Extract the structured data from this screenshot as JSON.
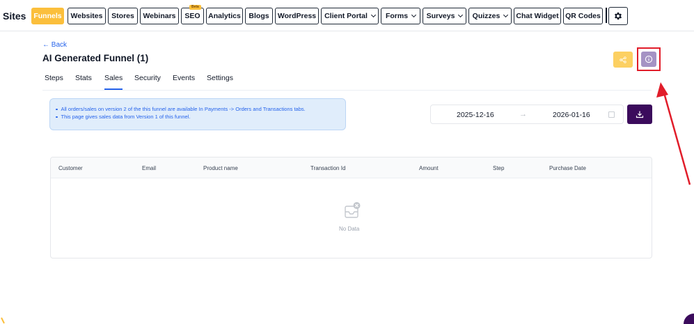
{
  "nav": {
    "title": "Sites",
    "items": [
      {
        "label": "Funnels",
        "dropdown": false,
        "active": true
      },
      {
        "label": "Websites",
        "dropdown": false
      },
      {
        "label": "Stores",
        "dropdown": false
      },
      {
        "label": "Webinars",
        "dropdown": false
      },
      {
        "label": "SEO",
        "dropdown": false,
        "badge": "Beta"
      },
      {
        "label": "Analytics",
        "dropdown": false
      },
      {
        "label": "Blogs",
        "dropdown": false
      },
      {
        "label": "WordPress",
        "dropdown": false
      },
      {
        "label": "Client Portal",
        "dropdown": true
      },
      {
        "label": "Forms",
        "dropdown": true
      },
      {
        "label": "Surveys",
        "dropdown": true
      },
      {
        "label": "Quizzes",
        "dropdown": true
      },
      {
        "label": "Chat Widget",
        "dropdown": false
      },
      {
        "label": "QR Codes",
        "dropdown": false
      }
    ],
    "settings_icon": "gear-icon"
  },
  "header": {
    "back_label": "← Back",
    "title": "AI Generated Funnel (1)",
    "share_icon": "share-icon",
    "info_icon": "info-icon"
  },
  "tabs": [
    {
      "label": "Steps"
    },
    {
      "label": "Stats"
    },
    {
      "label": "Sales",
      "active": true
    },
    {
      "label": "Security"
    },
    {
      "label": "Events"
    },
    {
      "label": "Settings"
    }
  ],
  "alert": {
    "lines": [
      "All orders/sales on version 2 of the this funnel are available In Payments -> Orders and Transactions tabs.",
      "This page gives sales data from Version 1 of this funnel."
    ]
  },
  "date_range": {
    "start": "2025-12-16",
    "separator": "→",
    "end": "2026-01-16"
  },
  "table": {
    "columns": [
      "Customer",
      "Email",
      "Product name",
      "Transaction Id",
      "Amount",
      "Step",
      "Purchase Date"
    ],
    "rows": [],
    "empty_text": "No Data"
  },
  "colors": {
    "accent_yellow": "#fbbf3c",
    "download_purple": "#3b0b5c",
    "info_purple": "#a593c4",
    "link_blue": "#2563eb",
    "annotation_red": "#e11d2a"
  }
}
